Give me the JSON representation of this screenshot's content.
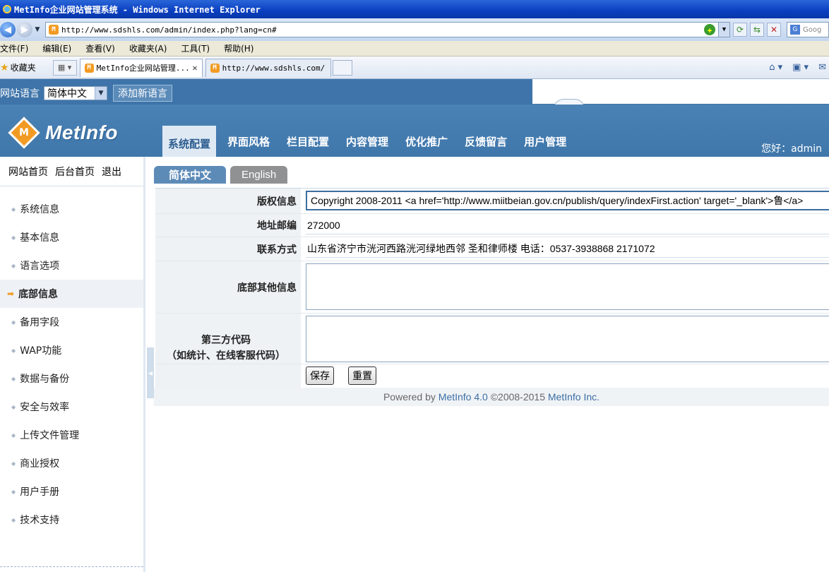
{
  "browser": {
    "title": "MetInfo企业网站管理系统 - Windows Internet Explorer",
    "url": "http://www.sdshls.com/admin/index.php?lang=cn#",
    "search_placeholder": "Goog",
    "menu": [
      "文件(F)",
      "编辑(E)",
      "查看(V)",
      "收藏夹(A)",
      "工具(T)",
      "帮助(H)"
    ],
    "favorites_label": "收藏夹",
    "tabs": [
      {
        "label": "MetInfo企业网站管理...",
        "active": true
      },
      {
        "label": "http://www.sdshls.com/...",
        "active": false
      }
    ]
  },
  "header": {
    "lang_label": "网站语言",
    "lang_selected": "简体中文",
    "add_lang_button": "添加新语言",
    "logo_text": "MetInfo",
    "logo_mark": "M",
    "nav": [
      "系统配置",
      "界面风格",
      "栏目配置",
      "内容管理",
      "优化推广",
      "反馈留言",
      "用户管理"
    ],
    "nav_active": 0,
    "greeting": "您好：admin"
  },
  "sidebar": {
    "top_links": [
      "网站首页",
      "后台首页",
      "退出"
    ],
    "items": [
      "系统信息",
      "基本信息",
      "语言选项",
      "底部信息",
      "备用字段",
      "WAP功能",
      "数据与备份",
      "安全与效率",
      "上传文件管理",
      "商业授权",
      "用户手册",
      "技术支持"
    ],
    "active_index": 3
  },
  "content": {
    "lang_tabs": [
      "简体中文",
      "English"
    ],
    "form": {
      "copyright_label": "版权信息",
      "copyright_value": "Copyright 2008-2011 <a href='http://www.miitbeian.gov.cn/publish/query/indexFirst.action' target='_blank'>鲁</a>",
      "address_zip_label": "地址邮编",
      "address_zip_value": "272000",
      "contact_label": "联系方式",
      "contact_value": "山东省济宁市洸河西路洸河绿地西邻 圣和律师楼    电话：0537-3938868 2171072",
      "footer_other_label": "底部其他信息",
      "footer_other_value": "",
      "third_party_label_line1": "第三方代码",
      "third_party_label_line2": "（如统计、在线客服代码）",
      "third_party_value": "",
      "save_button": "保存",
      "reset_button": "重置"
    },
    "footer": {
      "powered_by": "Powered by",
      "product_link": "MetInfo 4.0",
      "copyright": "©2008-2015",
      "company_link": "MetInfo Inc."
    }
  },
  "colors": {
    "header_blue": "#3e74a9",
    "accent_orange": "#f29b24",
    "active_lang_tab": "#5d8bb8"
  }
}
